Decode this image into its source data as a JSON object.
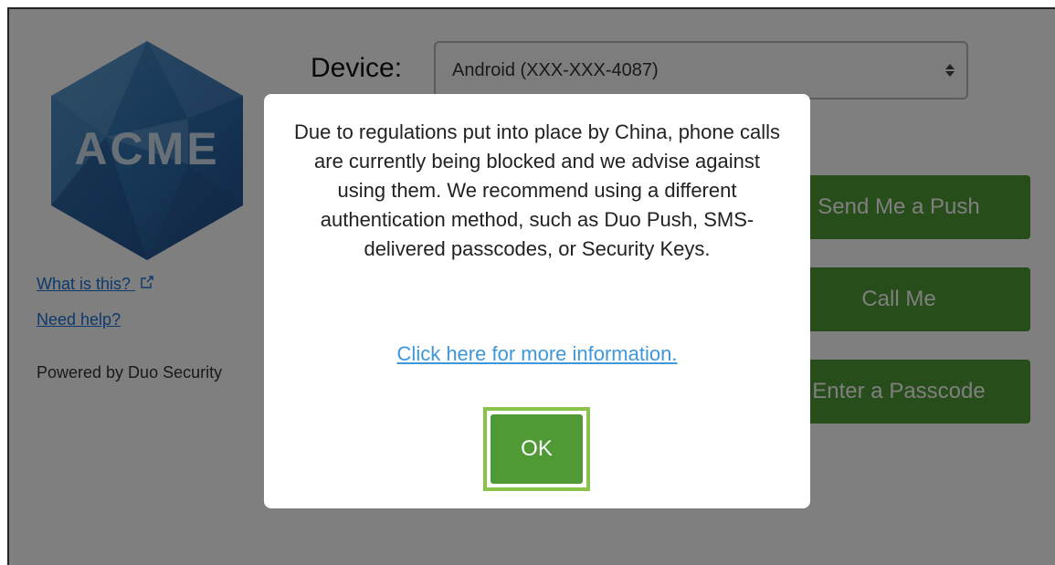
{
  "logo": {
    "text": "ACME",
    "icon": "acme-hexagon-logo"
  },
  "links": {
    "what_is_this": "What is this?",
    "need_help": "Need help?"
  },
  "powered_by": "Powered by Duo Security",
  "device": {
    "label": "Device:",
    "selected": "Android (XXX-XXX-4087)"
  },
  "actions": {
    "push": "Send Me a Push",
    "call": "Call Me",
    "passcode": "Enter a Passcode"
  },
  "modal": {
    "message": "Due to regulations put into place by China, phone calls are currently being blocked and we advise against using them. We recommend using a different authentication method, such as Duo Push, SMS-delivered passcodes, or Security Keys.",
    "link": "Click here for more information.",
    "ok": "OK"
  },
  "colors": {
    "button_green": "#4f9a34",
    "focus_ring": "#8bc34a",
    "link_blue": "#1a73d9",
    "modal_link_blue": "#3d97d8"
  }
}
